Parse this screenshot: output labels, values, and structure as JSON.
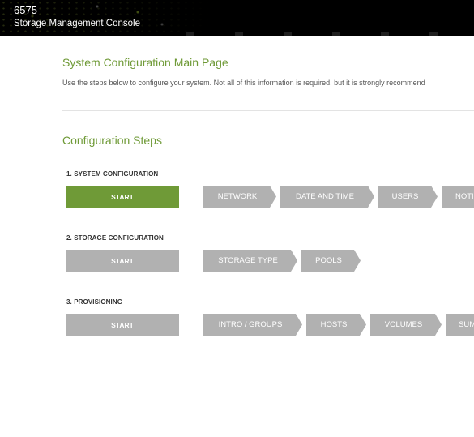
{
  "header": {
    "product_model": "6575",
    "console_name": "Storage Management Console"
  },
  "main": {
    "page_title": "System Configuration Main Page",
    "intro_text": "Use the steps below to configure your system. Not all of this information is required, but it is strongly recommend",
    "section_title": "Configuration Steps"
  },
  "steps": [
    {
      "title": "1. SYSTEM CONFIGURATION",
      "start_label": "START",
      "substeps": [
        "NETWORK",
        "DATE AND TIME",
        "USERS",
        "NOTI"
      ]
    },
    {
      "title": "2. STORAGE CONFIGURATION",
      "start_label": "START",
      "substeps": [
        "STORAGE TYPE",
        "POOLS"
      ]
    },
    {
      "title": "3. PROVISIONING",
      "start_label": "START",
      "substeps": [
        "INTRO / GROUPS",
        "HOSTS",
        "VOLUMES",
        "SUM"
      ]
    }
  ],
  "colors": {
    "accent_green": "#6f9a37",
    "inactive_gray": "#b1b1b1",
    "header_bg": "#000000"
  }
}
